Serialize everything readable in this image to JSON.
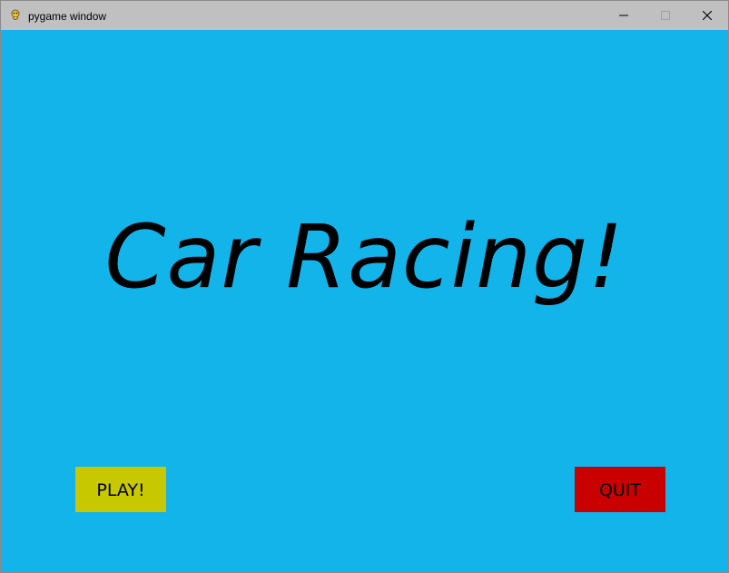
{
  "window": {
    "title": "pygame window",
    "app_icon": "pygame-snake-icon",
    "controls": {
      "minimize_icon": "minimize-icon",
      "maximize_icon": "maximize-icon",
      "close_icon": "close-icon"
    }
  },
  "game": {
    "title": "Car Racing!",
    "background_color": "#12b4ea",
    "buttons": {
      "play_label": "PLAY!",
      "play_color": "#c8c800",
      "quit_label": "QUIT",
      "quit_color": "#c80000"
    }
  }
}
